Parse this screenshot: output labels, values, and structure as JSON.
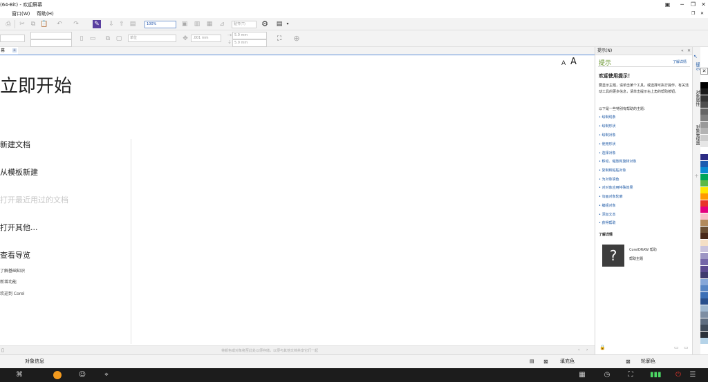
{
  "window": {
    "title": "(64-Bit) - 欢迎屏幕"
  },
  "menu": {
    "items": [
      "窗口(W)",
      "帮助(H)"
    ]
  },
  "toolbar": {
    "zoom_value": "100%",
    "snap_label": "贴齐(T)",
    "nudge_value": ".001 mm",
    "duplicate_x": "5.0 mm",
    "duplicate_y": "5.0 mm",
    "units_label": "单位"
  },
  "tab": {
    "label": "幕"
  },
  "welcome": {
    "title": "立即开始",
    "font_small": "A",
    "font_large": "A",
    "links": [
      "新建文档",
      "从模板新建",
      "打开最近用过的文档",
      "打开其他...",
      "查看导览"
    ],
    "small_links": [
      "了解基础知识",
      "新增功能",
      "欢迎到 Corel"
    ]
  },
  "canvas_hint": "将颜色或对象拖至此处以便存储，以便与其他文档共享它们一起",
  "hints_docker": {
    "header": "提示(N)",
    "title": "提示",
    "learn_more_link": "了解详情",
    "welcome_heading": "欢迎使用提示！",
    "intro": "要显示主题，请单击某个工具，或选择可执行操作。有关活动工具的更多信息，请单击提示右上角的帮助按钮。",
    "topics_heading": "以下是一些特别有帮助的主题：",
    "topics": [
      "绘制线条",
      "绘制形状",
      "绘制对象",
      "使用形状",
      "选择对象",
      "移动、缩放和旋转对象",
      "复制和粘贴对象",
      "为对象填色",
      "对对象应用特殊效果",
      "勾画对象轮廓",
      "编组对象",
      "添加文本",
      "获得帮助"
    ],
    "learn_more_heading": "了解详情",
    "help_name": "CorelDRAW 帮助",
    "help_topic": "帮助主题"
  },
  "side_tabs": [
    "提示",
    "对象属性",
    "对象管理器"
  ],
  "status": {
    "object_info": "对象信息",
    "fill_label": "填充色",
    "outline_label": "轮廓色"
  },
  "palette": [
    "#ffffff",
    "#000000",
    "#1a1a1a",
    "#333333",
    "#4d4d4d",
    "#666666",
    "#808080",
    "#999999",
    "#b3b3b3",
    "#cccccc",
    "#e6e6e6",
    "#ffffff",
    "#2c2c84",
    "#1c5cb0",
    "#0c8bd2",
    "#00a65a",
    "#5db946",
    "#ffe600",
    "#ff9900",
    "#e8332a",
    "#e4007f",
    "#f9bfc9",
    "#b28a5c",
    "#6b4f33",
    "#4a2a1a",
    "#f4dfc5",
    "#c9c3dd",
    "#9d96c4",
    "#7466a8",
    "#5b4a90",
    "#3f3a6e",
    "#86a7d8",
    "#5886c4",
    "#3b6fb6",
    "#284f8c",
    "#9eb7cf",
    "#7d8ea3",
    "#5e6d80",
    "#3f4b5a",
    "#2a313b",
    "#b5d3e8"
  ],
  "colors": {
    "accent": "#5b8edb",
    "link": "#1f5aa6",
    "hint_title": "#5d8c1f"
  }
}
